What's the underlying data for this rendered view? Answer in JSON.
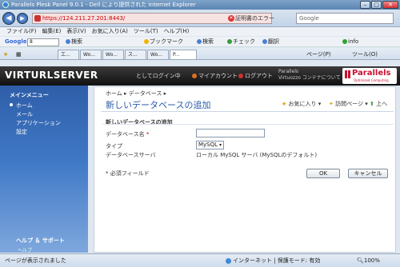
{
  "window": {
    "title": "Parallels Plesk Panel 9.0.1 - Dell により提供された Internet Explorer"
  },
  "address": {
    "url": "https://124.211.27.201:8443/",
    "cert_error": "証明書のエラー",
    "search_placeholder": "Google"
  },
  "menu": [
    "ファイル(F)",
    "編集(E)",
    "表示(V)",
    "お気に入り(A)",
    "ツール(T)",
    "ヘルプ(H)"
  ],
  "google_bar": {
    "label": "Google",
    "search_value": "8",
    "search_label": "検索",
    "bookmarks": "ブックマーク",
    "search2": "検索",
    "check": "チェック",
    "translate": "翻訳",
    "info": "info"
  },
  "tabs": [
    "エ...",
    "Wo...",
    "Wo...",
    "ス...",
    "Wo...",
    "P..."
  ],
  "commands": {
    "page": "ページ(P)",
    "tools": "ツール(O)"
  },
  "header": {
    "brand": "VIRTURLSERVER",
    "login_as": "としてログイン中",
    "my_account": "マイアカウント",
    "logout": "ログアウト",
    "right_line1": "Parallels",
    "right_line2": "Virtuozzo コンテナについて",
    "logo_word": "Parallels",
    "logo_sub": "Optimized Computing"
  },
  "sidebar": {
    "title": "メインメニュー",
    "items": [
      "ホーム",
      "メール",
      "アプリケーション",
      "設定"
    ],
    "help_title": "ヘルプ ＆ サポート",
    "help_item": "ヘルプ"
  },
  "content": {
    "breadcrumb": "ホーム ▸ データベース ▸",
    "title": "新しいデータベースの追加",
    "favorites": "お気に入り",
    "visited": "訪問ページ",
    "up": "上へ",
    "section_title": "新しいデータベースの追加",
    "db_name_label": "データベース名",
    "req_mark": "*",
    "type_label": "タイプ",
    "type_value": "MySQL",
    "server_label": "データベースサーバ",
    "server_value": "ローカル MySQL サーバ (MySQLのデフォルト)",
    "required_note": "* 必須フィールド",
    "ok": "OK",
    "cancel": "キャンセル"
  },
  "status": {
    "left": "ページが表示されました",
    "zone": "インターネット | 保護モード: 有効",
    "zoom": "100%"
  }
}
